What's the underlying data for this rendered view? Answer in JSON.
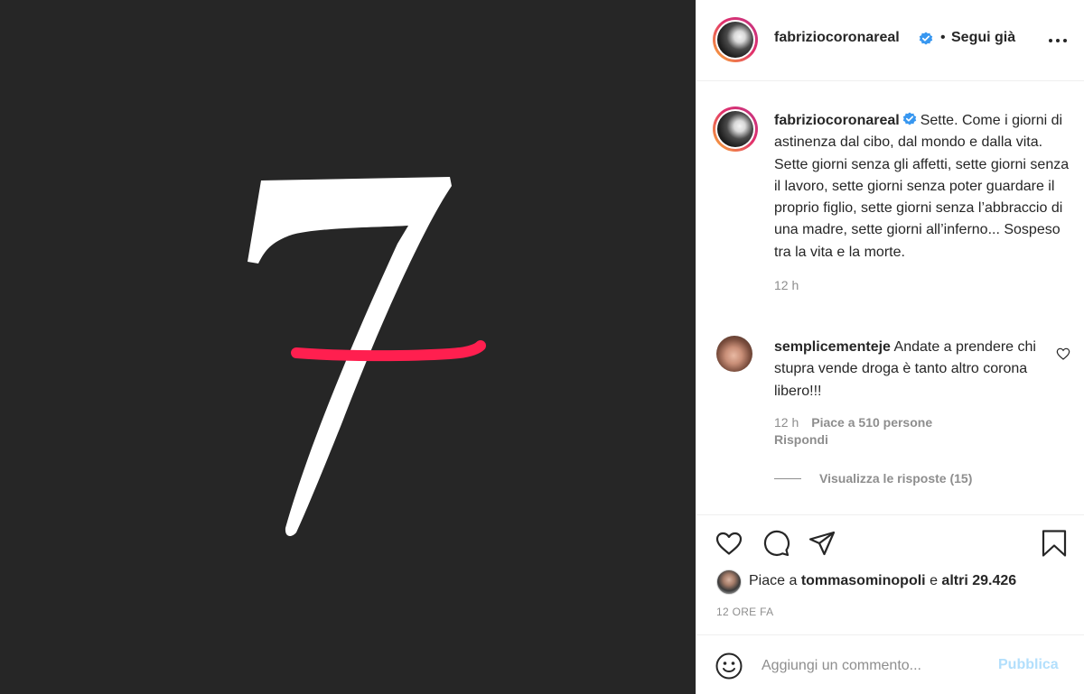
{
  "post_image": {
    "numeral": "7",
    "background_color": "#262626",
    "numeral_color": "#ffffff",
    "strike_color": "#ff1f4f"
  },
  "header": {
    "username": "fabriziocoronareal",
    "verified_icon": "verified-badge-icon",
    "separator": "•",
    "follow_label": "Segui già",
    "more_icon": "more-options-icon"
  },
  "caption": {
    "username": "fabriziocoronareal",
    "text": "Sette. Come i giorni di astinenza dal cibo, dal mondo e dalla vita. Sette giorni senza gli affetti, sette giorni senza il lavoro, sette giorni senza poter guardare il proprio figlio, sette giorni senza l’abbraccio di una madre, sette giorni all’inferno... Sospeso tra la vita e la morte.",
    "time": "12 h"
  },
  "comment": {
    "username": "semplicementeje",
    "text": "Andate a prendere chi stupra vende droga è tanto altro corona libero!!!",
    "time": "12 h",
    "likes": "Piace a 510 persone",
    "reply_label": "Rispondi",
    "view_replies_label": "Visualizza le risposte (15)"
  },
  "actions": {
    "icons": [
      "heart-icon",
      "comment-icon",
      "share-icon",
      "bookmark-icon"
    ],
    "likes_prefix": "Piace a",
    "likes_user": "tommasominopoli",
    "likes_and": "e",
    "likes_others": "altri 29.426",
    "posted_ago": "12 ORE FA"
  },
  "add_comment": {
    "placeholder": "Aggiungi un commento...",
    "publish_label": "Pubblica",
    "publish_color": "#b2dffc"
  }
}
